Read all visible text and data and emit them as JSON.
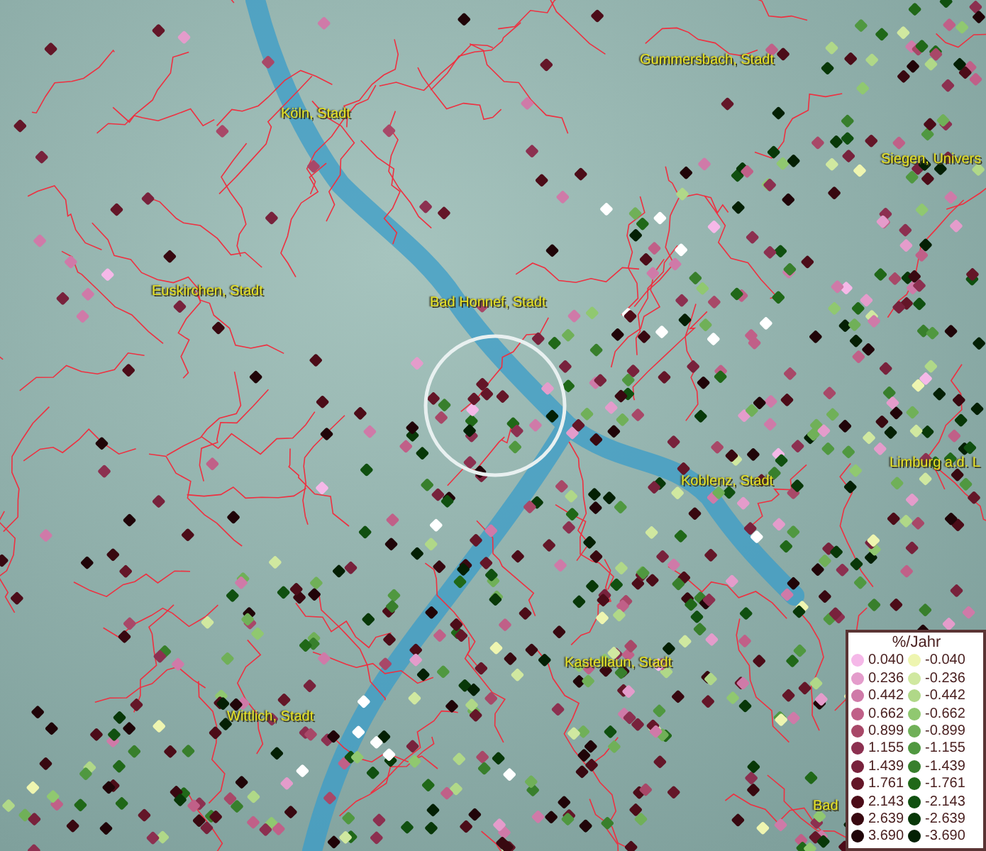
{
  "map": {
    "labels": [
      "Gummersbach, Stadt",
      "Köln, Stadt",
      "Siegen, Univers",
      "Euskirchen, Stadt",
      "Bad Honnef, Stadt",
      "Limburg a.d. L",
      "Koblenz, Stadt",
      "Kastellaun, Stadt",
      "Wittlich, Stadt",
      "Bad"
    ]
  },
  "legend": {
    "title": "%/Jahr",
    "positive": [
      {
        "value": "0.040",
        "color": "#f5b8e8"
      },
      {
        "value": "0.236",
        "color": "#e49ccb"
      },
      {
        "value": "0.442",
        "color": "#cf7aa8"
      },
      {
        "value": "0.662",
        "color": "#c06088"
      },
      {
        "value": "0.899",
        "color": "#a84868"
      },
      {
        "value": "1.155",
        "color": "#8c3050"
      },
      {
        "value": "1.439",
        "color": "#78223c"
      },
      {
        "value": "1.761",
        "color": "#641628"
      },
      {
        "value": "2.143",
        "color": "#4c0c18"
      },
      {
        "value": "2.639",
        "color": "#380810"
      },
      {
        "value": "3.690",
        "color": "#200408"
      }
    ],
    "negative": [
      {
        "value": "-0.040",
        "color": "#eef5b0"
      },
      {
        "value": "-0.236",
        "color": "#d0e8a0"
      },
      {
        "value": "-0.442",
        "color": "#b0d888"
      },
      {
        "value": "-0.662",
        "color": "#90c870"
      },
      {
        "value": "-0.899",
        "color": "#70b058"
      },
      {
        "value": "-1.155",
        "color": "#509840"
      },
      {
        "value": "-1.439",
        "color": "#387f2c"
      },
      {
        "value": "-1.761",
        "color": "#206818"
      },
      {
        "value": "-2.143",
        "color": "#105010"
      },
      {
        "value": "-2.639",
        "color": "#083808"
      },
      {
        "value": "-3.690",
        "color": "#042004"
      }
    ]
  }
}
